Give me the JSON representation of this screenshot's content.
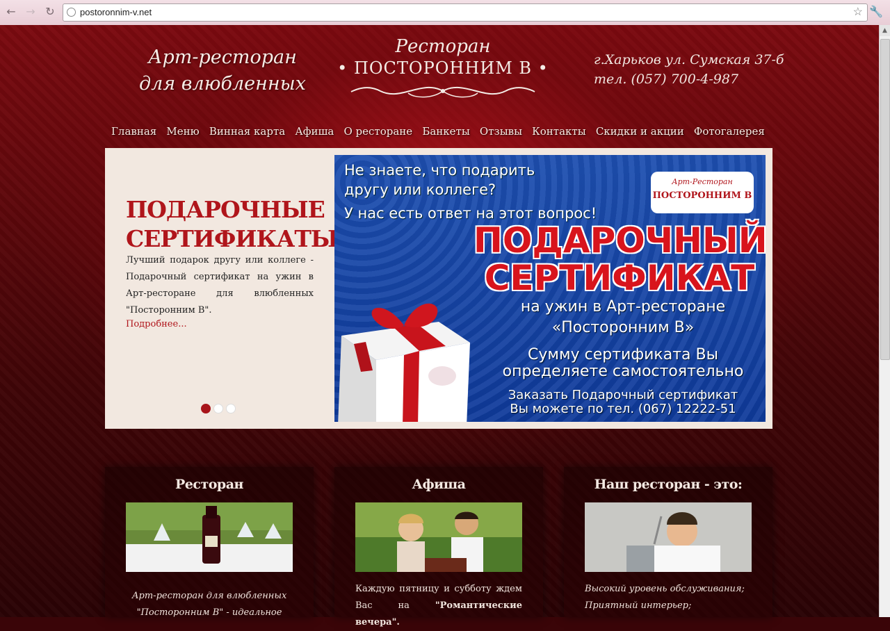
{
  "browser": {
    "url": "postoronnim-v.net"
  },
  "header": {
    "tagline_line1": "Арт-ресторан",
    "tagline_line2": "для влюбленных",
    "logo_small": "Ресторан",
    "logo_big": "• ПОСТОРОННИМ В •",
    "address": "г.Харьков ул. Сумская 37-б",
    "phone": "тел. (057) 700-4-987"
  },
  "menu": [
    "Главная",
    "Меню",
    "Винная карта",
    "Афиша",
    "О ресторане",
    "Банкеты",
    "Отзывы",
    "Контакты",
    "Скидки и акции",
    "Фотогалерея"
  ],
  "slider": {
    "title_line1": "ПОДАРОЧНЫЕ",
    "title_line2": "СЕРТИФИКАТЫ",
    "text": "Лучший подарок другу или коллеге - Подарочный сертификат на ужин в Арт-ресторане для влюбленных \"Посторонним В\".",
    "more": "Подробнее...",
    "dots": 3,
    "active_dot": 0,
    "banner": {
      "question_line1": "Не знаете, что подарить",
      "question_line2": "другу или коллеге?",
      "answer": "У нас есть ответ на этот вопрос!",
      "logo_line1": "Арт-Ресторан",
      "logo_line2": "ПОСТОРОННИМ В",
      "big_line1": "ПОДАРОЧНЫЙ",
      "big_line2": "СЕРТИФИКАТ",
      "sub_line1": "на ужин в Арт-ресторане",
      "sub_line2": "«Посторонним В»",
      "sum_line1": "Сумму сертификата Вы",
      "sum_line2": "определяете самостоятельно",
      "order_line1": "Заказать Подарочный сертификат",
      "order_line2": "Вы можете по тел. (067) 12222-51"
    }
  },
  "cards": [
    {
      "title": "Ресторан",
      "text": "Арт-ресторан для влюбленных \"Посторонним В\" - идеальное"
    },
    {
      "title": "Афиша",
      "text_before": "Каждую пятницу и субботу ждем Вас на ",
      "text_bold": "\"Романтические вечера\"."
    },
    {
      "title": "Наш ресторан - это:",
      "line1": "Высокий уровень обслуживания;",
      "line2": "Приятный интерьер;"
    }
  ],
  "colors": {
    "accent_red": "#b0151b",
    "banner_blue": "#1d4fb0",
    "page_dark": "#3a0508"
  }
}
